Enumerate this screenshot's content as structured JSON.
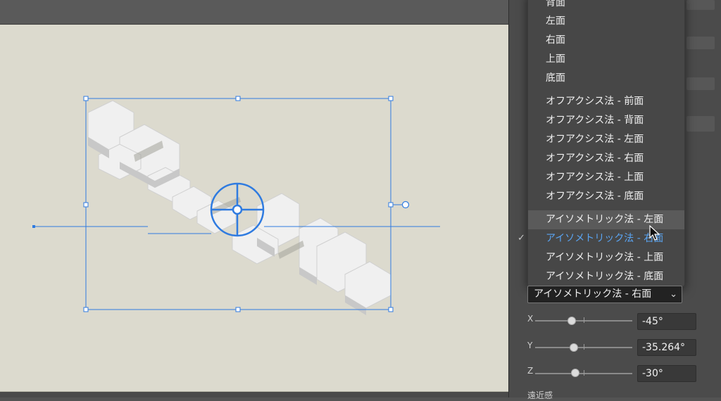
{
  "menu": {
    "items": [
      {
        "label": "背面"
      },
      {
        "label": "左面"
      },
      {
        "label": "右面"
      },
      {
        "label": "上面"
      },
      {
        "label": "底面"
      },
      {
        "label": "オフアクシス法 - 前面"
      },
      {
        "label": "オフアクシス法 - 背面"
      },
      {
        "label": "オフアクシス法 - 左面"
      },
      {
        "label": "オフアクシス法 - 右面"
      },
      {
        "label": "オフアクシス法 - 上面"
      },
      {
        "label": "オフアクシス法 - 底面"
      },
      {
        "label": "アイソメトリック法 - 左面"
      },
      {
        "label": "アイソメトリック法 - 右面"
      },
      {
        "label": "アイソメトリック法 - 上面"
      },
      {
        "label": "アイソメトリック法 - 底面"
      }
    ],
    "checkmark": "✓"
  },
  "position_select": {
    "value": "アイソメトリック法 - 右面",
    "chevron": "⌄"
  },
  "rotation": {
    "x": {
      "label": "X",
      "value": "-45°",
      "level": -45
    },
    "y": {
      "label": "Y",
      "value": "-35.264°",
      "level": -35.264
    },
    "z": {
      "label": "Z",
      "value": "-30°",
      "level": -30
    }
  },
  "perspective_label": "遠近感",
  "colors": {
    "accent": "#2f7be0",
    "selected_text": "#5aa4f2",
    "artboard": "#dcdace",
    "panel": "#4b4b4b"
  }
}
